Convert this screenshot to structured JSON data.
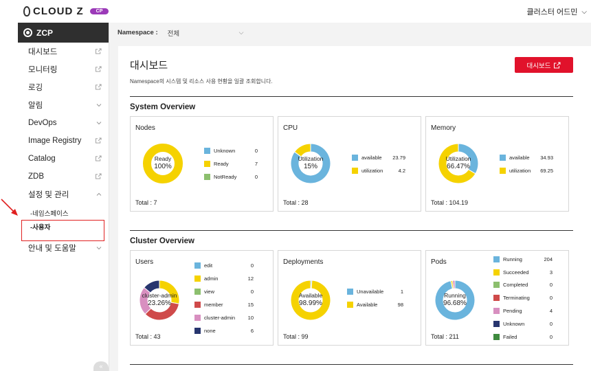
{
  "header": {
    "logo_text": "CLOUD Z",
    "logo_badge": "CP",
    "user_menu": "클러스터 어드민"
  },
  "sidebar": {
    "title": "ZCP",
    "items": [
      {
        "label": "대시보드",
        "icon": "external-link-icon"
      },
      {
        "label": "모니터링",
        "icon": "external-link-icon"
      },
      {
        "label": "로깅",
        "icon": "external-link-icon"
      },
      {
        "label": "알림",
        "icon": "chevron-down-icon"
      },
      {
        "label": "DevOps",
        "icon": "chevron-down-icon"
      },
      {
        "label": "Image Registry",
        "icon": "external-link-icon"
      },
      {
        "label": "Catalog",
        "icon": "external-link-icon"
      },
      {
        "label": "ZDB",
        "icon": "external-link-icon"
      },
      {
        "label": "설정 및 관리",
        "icon": "chevron-up-icon"
      }
    ],
    "sub_items": [
      {
        "label": "-네임스페이스"
      },
      {
        "label": "-사용자",
        "active": true
      }
    ],
    "last_item": {
      "label": "안내 및 도움말",
      "icon": "chevron-down-icon"
    },
    "collapse_label": "«"
  },
  "namespace_bar": {
    "label": "Namespace :",
    "value": "전체"
  },
  "page": {
    "title": "대시보드",
    "description": "Namespace의 시스템 및 리소스 사용 현황을 일괄 조회합니다.",
    "dashboard_button": "대시보드"
  },
  "system_overview": {
    "title": "System Overview",
    "cards": [
      {
        "title": "Nodes",
        "center_label": "Ready",
        "center_value": "100%",
        "total": "Total : 7",
        "legend": [
          {
            "name": "Unknown",
            "value": 0,
            "color": "#6ab4dd"
          },
          {
            "name": "Ready",
            "value": 7,
            "color": "#f5d200"
          },
          {
            "name": "NotReady",
            "value": 0,
            "color": "#8cbf6e"
          }
        ]
      },
      {
        "title": "CPU",
        "center_label": "Utilization",
        "center_value": "15%",
        "total": "Total : 28",
        "legend": [
          {
            "name": "available",
            "value": 23.79,
            "color": "#6ab4dd"
          },
          {
            "name": "utilization",
            "value": 4.2,
            "color": "#f5d200"
          }
        ]
      },
      {
        "title": "Memory",
        "center_label": "Utilization",
        "center_value": "66.47%",
        "total": "Total : 104.19",
        "legend": [
          {
            "name": "available",
            "value": 34.93,
            "color": "#6ab4dd"
          },
          {
            "name": "utilization",
            "value": 69.25,
            "color": "#f5d200"
          }
        ]
      }
    ]
  },
  "cluster_overview": {
    "title": "Cluster Overview",
    "cards": [
      {
        "title": "Users",
        "center_label": "cluster-admin",
        "center_value": "23.26%",
        "total": "Total : 43",
        "legend": [
          {
            "name": "edit",
            "value": 0,
            "color": "#6ab4dd"
          },
          {
            "name": "admin",
            "value": 12,
            "color": "#f5d200"
          },
          {
            "name": "view",
            "value": 0,
            "color": "#8cbf6e"
          },
          {
            "name": "member",
            "value": 15,
            "color": "#cf4a4a"
          },
          {
            "name": "cluster-admin",
            "value": 10,
            "color": "#d88fc0"
          },
          {
            "name": "none",
            "value": 6,
            "color": "#27356e"
          }
        ]
      },
      {
        "title": "Deployments",
        "center_label": "Available",
        "center_value": "98.99%",
        "total": "Total : 99",
        "legend": [
          {
            "name": "Unavailable",
            "value": 1,
            "color": "#6ab4dd"
          },
          {
            "name": "Available",
            "value": 98,
            "color": "#f5d200"
          }
        ]
      },
      {
        "title": "Pods",
        "center_label": "Running",
        "center_value": "96.68%",
        "total": "Total : 211",
        "legend": [
          {
            "name": "Running",
            "value": 204,
            "color": "#6ab4dd"
          },
          {
            "name": "Succeeded",
            "value": 3,
            "color": "#f5d200"
          },
          {
            "name": "Completed",
            "value": 0,
            "color": "#8cbf6e"
          },
          {
            "name": "Terminating",
            "value": 0,
            "color": "#cf4a4a"
          },
          {
            "name": "Pending",
            "value": 4,
            "color": "#d88fc0"
          },
          {
            "name": "Unknown",
            "value": 0,
            "color": "#27356e"
          },
          {
            "name": "Failed",
            "value": 0,
            "color": "#3e8a3e"
          }
        ]
      }
    ]
  }
}
